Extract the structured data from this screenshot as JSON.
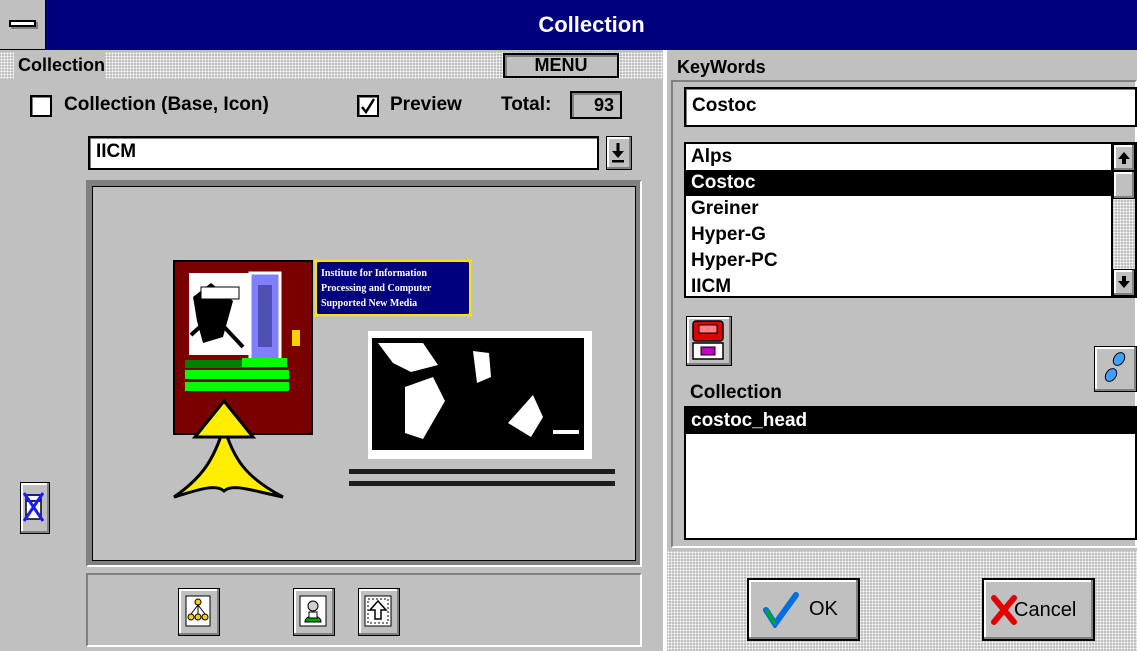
{
  "window": {
    "title": "Collection"
  },
  "left": {
    "header": "Collection",
    "menu_label": "MENU",
    "collection_checkbox_label": "Collection (Base, Icon)",
    "collection_checked": false,
    "preview_label": "Preview",
    "preview_checked": true,
    "total_label": "Total:",
    "total_value": "93",
    "selected_collection": "IICM",
    "preview": {
      "info_sign": "Institute for Information Processing and Computer Supported New Media"
    }
  },
  "right": {
    "keywords_header": "KeyWords",
    "keyword_value": "Costoc",
    "keywords": [
      "Alps",
      "Costoc",
      "Greiner",
      "Hyper-G",
      "Hyper-PC",
      "IICM"
    ],
    "selected_keyword": "Costoc",
    "collection_header": "Collection",
    "collection_items": [
      "costoc_head"
    ]
  },
  "buttons": {
    "ok_label": "OK",
    "cancel_label": "Cancel"
  },
  "colors": {
    "titlebar": "#00007f",
    "face": "#c0c0c0",
    "ok_check": "#0070e0",
    "cancel_x": "#e00000"
  },
  "icons": [
    "system-menu-icon",
    "clear-collection-icon",
    "hierarchy-icon",
    "user-icon",
    "goto-parent-icon",
    "scroll-up-arrow-icon",
    "scroll-down-arrow-icon",
    "dropdown-arrow-icon",
    "add-collection-icon",
    "footprints-icon",
    "checkmark-icon",
    "x-icon"
  ]
}
